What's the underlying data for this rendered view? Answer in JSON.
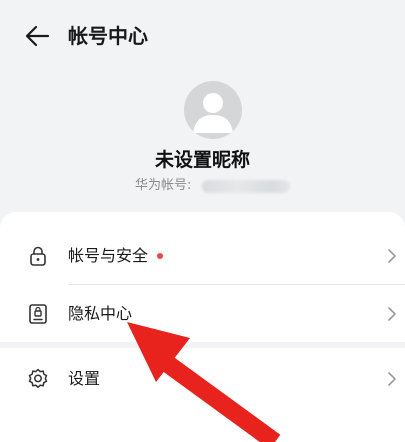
{
  "header": {
    "title": "帐号中心"
  },
  "profile": {
    "nickname": "未设置昵称",
    "account_label": "华为帐号:"
  },
  "menu": [
    {
      "label": "帐号与安全",
      "icon": "lock-icon",
      "has_dot": true
    },
    {
      "label": "隐私中心",
      "icon": "privacy-card-icon",
      "has_dot": false
    }
  ],
  "settings": {
    "label": "设置",
    "icon": "gear-icon"
  },
  "colors": {
    "accent_dot": "#e84a3c",
    "annotation_arrow": "#e8221d",
    "background": "#f1f3f5"
  }
}
